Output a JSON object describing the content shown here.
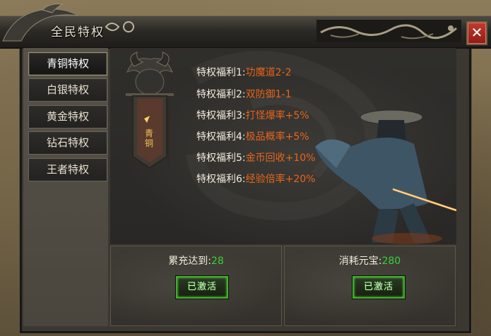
{
  "window": {
    "title": "全民特权",
    "close_label": "✕"
  },
  "nav": {
    "items": [
      {
        "label": "青铜特权",
        "active": true
      },
      {
        "label": "白银特权",
        "active": false
      },
      {
        "label": "黄金特权",
        "active": false
      },
      {
        "label": "钻石特权",
        "active": false
      },
      {
        "label": "王者特权",
        "active": false
      }
    ]
  },
  "badge": {
    "text": "青铜"
  },
  "perks": [
    {
      "label": "特权福利1:",
      "value": "功魔道2-2"
    },
    {
      "label": "特权福利2:",
      "value": "双防御1-1"
    },
    {
      "label": "特权福利3:",
      "value": "打怪爆率+5%"
    },
    {
      "label": "特权福利4:",
      "value": "极品概率+5%"
    },
    {
      "label": "特权福利5:",
      "value": "金币回收+10%"
    },
    {
      "label": "特权福利6:",
      "value": "经验倍率+20%"
    }
  ],
  "requirements": {
    "left": {
      "label": "累充达到:",
      "value": "28",
      "button": "已激活"
    },
    "right": {
      "label": "消耗元宝:",
      "value": "280",
      "button": "已激活"
    }
  },
  "colors": {
    "perk_value": "#e8651c",
    "req_number": "#36d336",
    "close_bg": "#c33a30"
  }
}
